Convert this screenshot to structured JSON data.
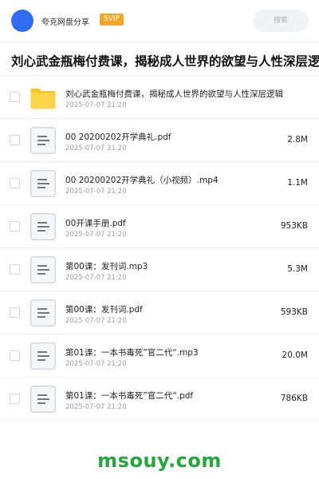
{
  "header": {
    "owner_name": "夸克网盘分享",
    "badge": "SVIP",
    "search_placeholder": "搜索"
  },
  "title": "刘心武金瓶梅付费课，揭秘成人世界的欲望与人性深层逻辑",
  "files": [
    {
      "type": "folder",
      "name": "刘心武金瓶梅付费课，揭秘成人世界的欲望与人性深层逻辑",
      "date": "2025-07-07 21:20",
      "size": ""
    },
    {
      "type": "doc",
      "name": "00 20200202开学典礼.pdf",
      "date": "2025-07-07 21:20",
      "size": "2.8M"
    },
    {
      "type": "doc",
      "name": "00 20200202开学典礼（小视频）.mp4",
      "date": "2025-07-07 21:20",
      "size": "1.1M"
    },
    {
      "type": "doc",
      "name": "00开课手册.pdf",
      "date": "2025-07-07 21:20",
      "size": "953KB"
    },
    {
      "type": "doc",
      "name": "第00课：发刊词.mp3",
      "date": "2025-07-07 21:20",
      "size": "5.3M"
    },
    {
      "type": "doc",
      "name": "第00课：发刊词.pdf",
      "date": "2025-07-07 21:20",
      "size": "593KB"
    },
    {
      "type": "doc",
      "name": "第01课：一本书毒死”官二代“.mp3",
      "date": "2025-07-07 21:20",
      "size": "20.0M"
    },
    {
      "type": "doc",
      "name": "第01课：一本书毒死”官二代“.pdf",
      "date": "2025-07-07 21:20",
      "size": "786KB"
    }
  ],
  "watermark": "msouy.com",
  "colors": {
    "accent": "#2f6bf3",
    "badge": "#f5a623",
    "folder": "#f7c325",
    "watermark": "#22a83a"
  }
}
